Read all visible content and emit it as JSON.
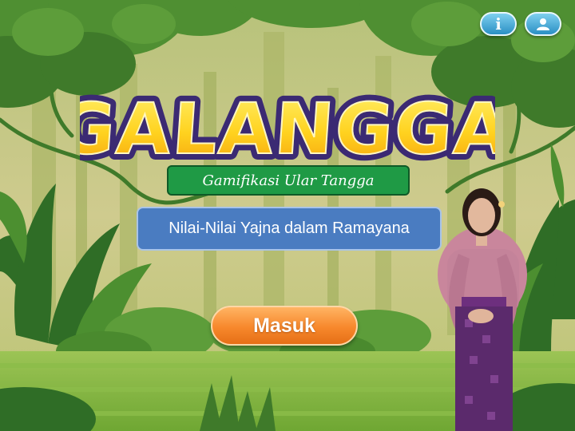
{
  "header": {
    "info_label": "i",
    "info_icon": "info-icon",
    "profile_icon": "user-icon"
  },
  "title": {
    "text": "GALANGGA",
    "fill_color": "#ffd21f",
    "outline_color": "#3b2a73"
  },
  "subtitle": {
    "text": "Gamifikasi Ular Tangga",
    "color": "#1f9a45"
  },
  "topic": {
    "text": "Nilai-Nilai Yajna dalam Ramayana",
    "color": "#4a7cc1"
  },
  "enter_button": {
    "label": "Masuk",
    "color": "#f7882c"
  },
  "background": {
    "theme": "jungle",
    "sky_color": "#c9c78a",
    "foliage_color": "#4f8f32",
    "ground_color": "#86b441"
  },
  "presenter": {
    "icon": "presenter-figure"
  }
}
